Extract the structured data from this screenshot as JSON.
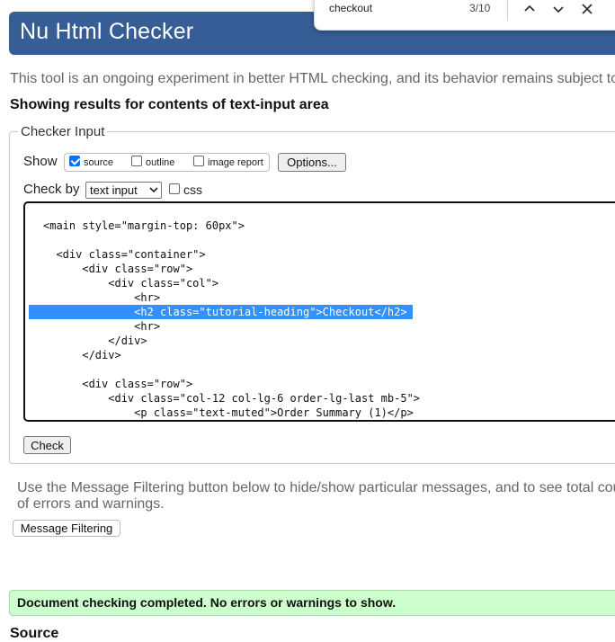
{
  "app": {
    "title": "Nu Html Checker"
  },
  "find": {
    "query": "checkout",
    "count": "3/10"
  },
  "intro": "This tool is an ongoing experiment in better HTML checking, and its behavior remains subject to",
  "showing": "Showing results for contents of text-input area",
  "checker_input": {
    "legend": "Checker Input",
    "show_label": "Show",
    "options": [
      {
        "label": "source",
        "checked": true
      },
      {
        "label": "outline",
        "checked": false
      },
      {
        "label": "image report",
        "checked": false
      }
    ],
    "options_button": "Options...",
    "check_by_label": "Check by",
    "check_by_value": "text input",
    "css_label": "css",
    "check_button": "Check"
  },
  "code_lines": [
    "<main style=\"margin-top: 60px\">",
    "",
    "  <div class=\"container\">",
    "      <div class=\"row\">",
    "          <div class=\"col\">",
    "              <hr>",
    "              <h2 class=\"tutorial-heading\">Checkout</h2>",
    "              <hr>",
    "          </div>",
    "      </div>",
    "",
    "      <div class=\"row\">",
    "          <div class=\"col-12 col-lg-6 order-lg-last mb-5\">",
    "              <p class=\"text-muted\">Order Summary (1)</p>"
  ],
  "filter_text": "Use the Message Filtering button below to hide/show particular messages, and to see total counts of errors and warnings.",
  "message_filtering_button": "Message Filtering",
  "success": "Document checking completed. No errors or warnings to show.",
  "source_heading": "Source",
  "colors": {
    "header": "#365d95",
    "highlight": "#3391ff",
    "success_bg": "#ccffcc"
  }
}
